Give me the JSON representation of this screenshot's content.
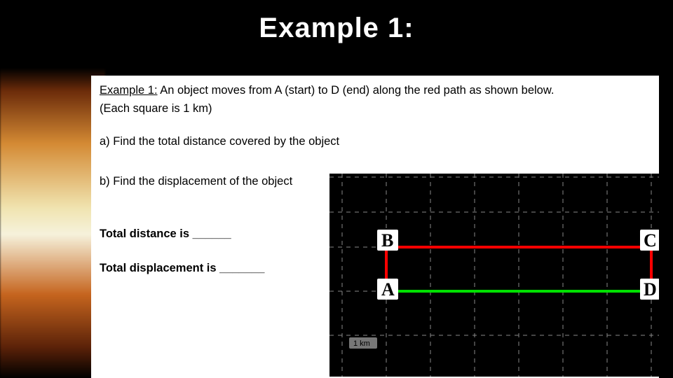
{
  "title": "Example 1:",
  "problem": {
    "lead": "Example 1:",
    "text": " An object moves from A (start) to D (end) along the red path as shown below.",
    "scale_note": "(Each square is 1 km)",
    "qa": "a) Find the total distance covered by the object",
    "qb": "b) Find the displacement of the object",
    "ans_dist_label": "Total distance is ______",
    "ans_disp_label": "Total displacement is _______"
  },
  "diagram": {
    "points": {
      "A": "A",
      "B": "B",
      "C": "C",
      "D": "D"
    },
    "grid_unit_label": "1 km",
    "grid_unit_km": 1,
    "red_path_segments_km": [
      {
        "from": "A",
        "to": "B",
        "length_km": 1
      },
      {
        "from": "B",
        "to": "C",
        "length_km": 6
      },
      {
        "from": "C",
        "to": "D",
        "length_km": 1
      }
    ],
    "green_segment": {
      "from": "A",
      "to": "D",
      "length_km": 6
    }
  }
}
